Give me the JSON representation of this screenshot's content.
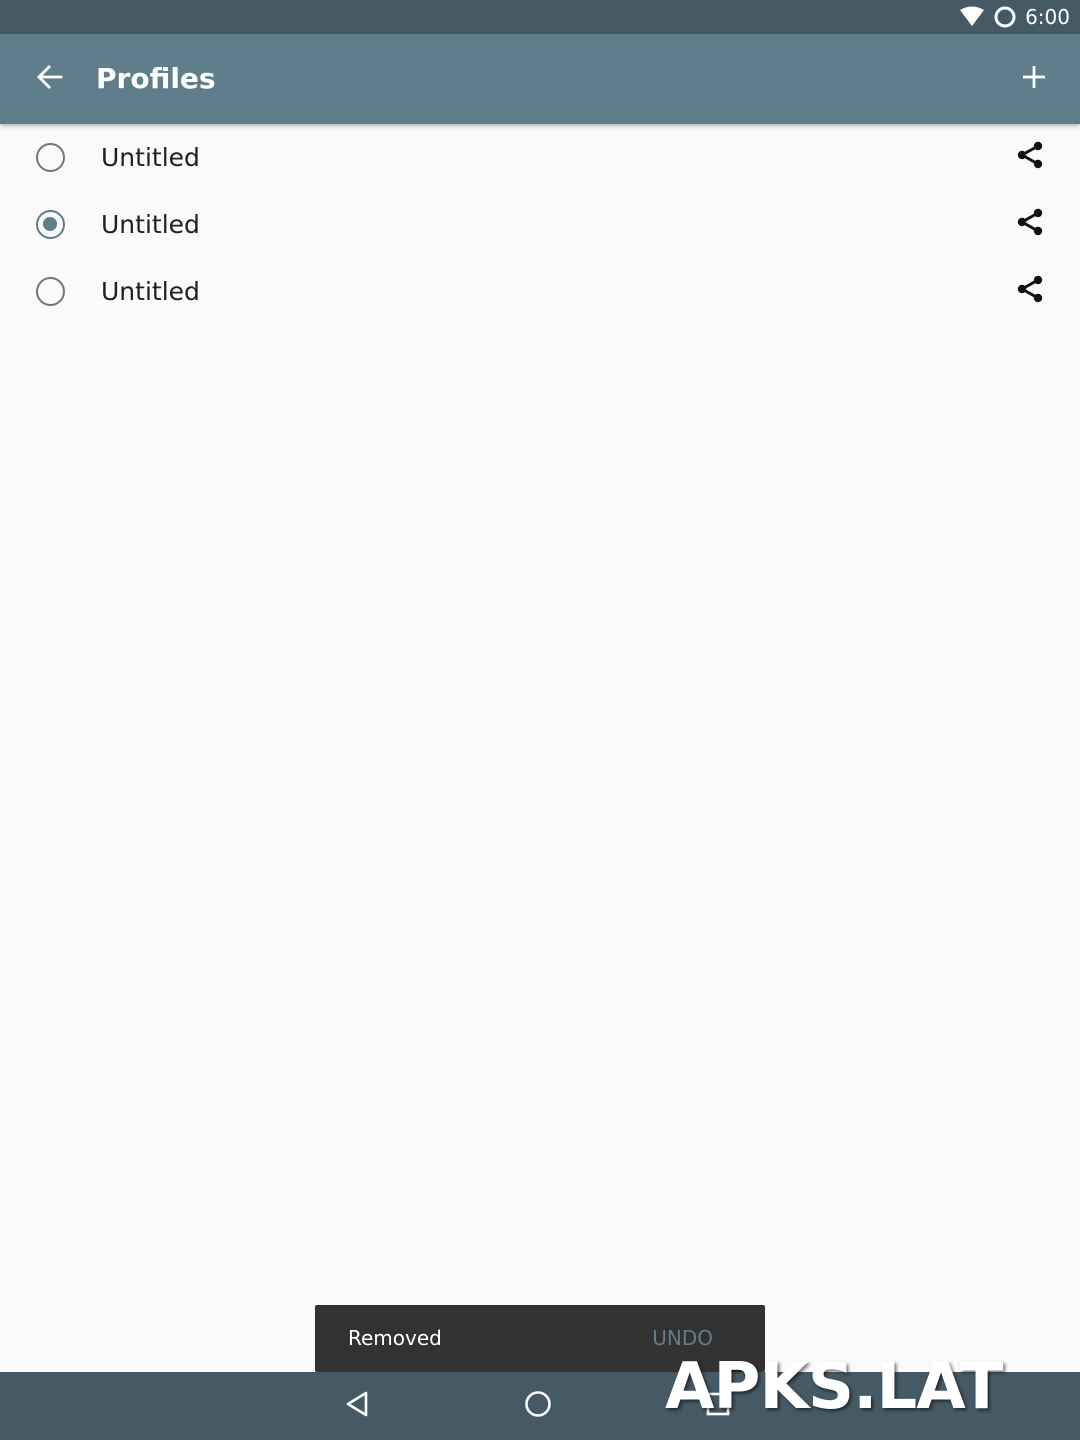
{
  "status_bar": {
    "time": "6:00",
    "icons": [
      "wifi-icon",
      "sync-ring-icon"
    ]
  },
  "toolbar": {
    "title": "Profiles",
    "back_icon": "arrow-back-icon",
    "add_icon": "plus-icon"
  },
  "profiles": [
    {
      "label": "Untitled",
      "selected": false
    },
    {
      "label": "Untitled",
      "selected": true
    },
    {
      "label": "Untitled",
      "selected": false
    }
  ],
  "snackbar": {
    "message": "Removed",
    "action": "UNDO"
  },
  "nav_bar": {
    "icons": [
      "nav-back-icon",
      "nav-home-icon",
      "nav-recents-icon"
    ]
  },
  "watermark": "APKS.LAT",
  "colors": {
    "toolbar": "#607d8b",
    "status_bar": "#455a64",
    "accent": "#607d8b",
    "background": "#fafafa",
    "snackbar": "#323232"
  }
}
